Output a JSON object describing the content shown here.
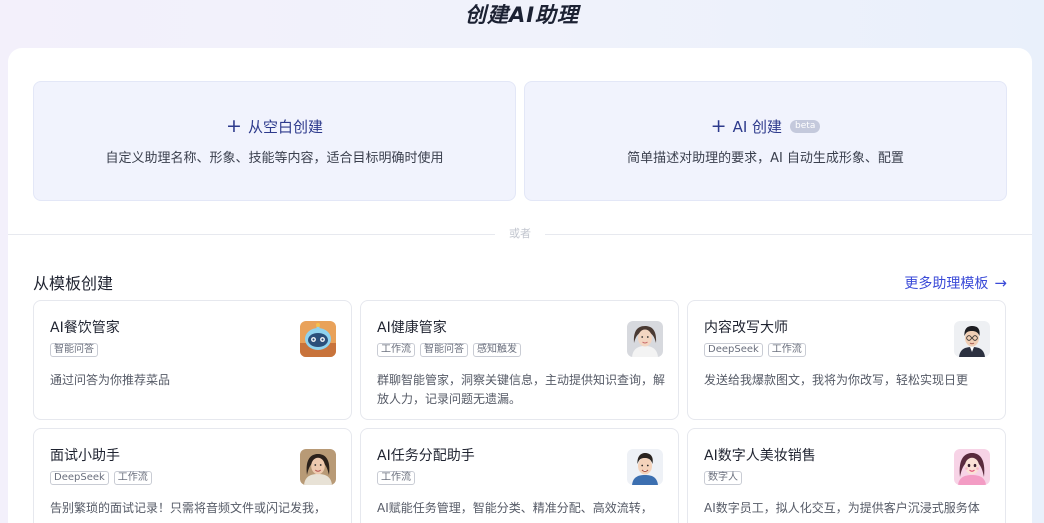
{
  "page_title": "创建AI助理",
  "create_blank": {
    "plus": "+",
    "title": "从空白创建",
    "desc": "自定义助理名称、形象、技能等内容，适合目标明确时使用"
  },
  "create_ai": {
    "plus": "+",
    "title": "AI 创建",
    "badge": "beta",
    "desc": "简单描述对助理的要求，AI 自动生成形象、配置"
  },
  "divider_text": "或者",
  "templates": {
    "section_title": "从模板创建",
    "more_label": "更多助理模板",
    "more_icon": "arrow-right-icon",
    "items": [
      {
        "name": "AI餐饮管家",
        "tags": [
          "智能问答"
        ],
        "desc": "通过问答为你推荐菜品",
        "icon": "robot-icon"
      },
      {
        "name": "AI健康管家",
        "tags": [
          "工作流",
          "智能问答",
          "感知触发"
        ],
        "desc": "群聊智能管家，洞察关键信息，主动提供知识查询，解放人力，记录问题无遗漏。",
        "icon": "woman-avatar"
      },
      {
        "name": "内容改写大师",
        "tags": [
          "DeepSeek",
          "工作流"
        ],
        "desc": "发送给我爆款图文，我将为你改写，轻松实现日更",
        "icon": "man-glasses-avatar"
      },
      {
        "name": "面试小助手",
        "tags": [
          "DeepSeek",
          "工作流"
        ],
        "desc": "告别繁琐的面试记录！只需将音频文件或闪记发我，",
        "icon": "woman-photo-avatar"
      },
      {
        "name": "AI任务分配助手",
        "tags": [
          "工作流"
        ],
        "desc": "AI赋能任务管理，智能分类、精准分配、高效流转，",
        "icon": "man-avatar"
      },
      {
        "name": "AI数字人美妆销售",
        "tags": [
          "数字人"
        ],
        "desc": "AI数字员工，拟人化交互，为提供客户沉浸式服务体",
        "icon": "cartoon-girl-avatar"
      }
    ]
  },
  "colors": {
    "accent": "#3b4bd8",
    "card_bg": "#f1f3fd",
    "title_blue": "#2d3a8c"
  }
}
